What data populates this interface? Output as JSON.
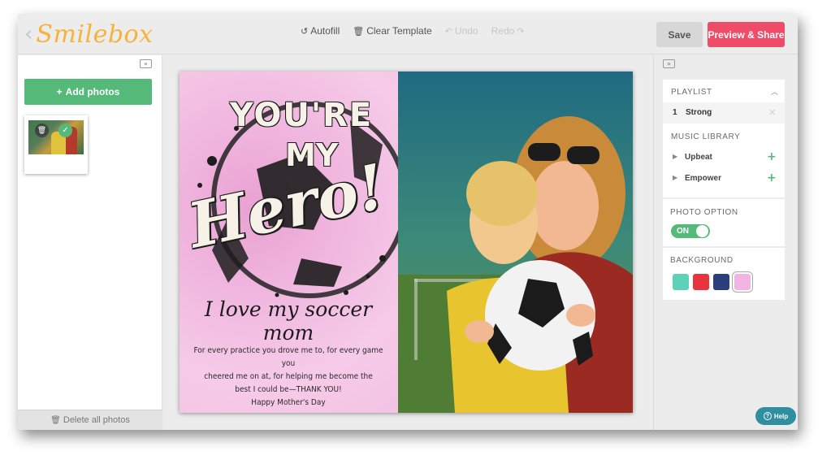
{
  "app": {
    "logo": "Smilebox"
  },
  "toolbar": {
    "autofill": "Autofill",
    "clear_template": "Clear Template",
    "undo": "Undo",
    "redo": "Redo",
    "save": "Save",
    "preview_share": "Preview & Share"
  },
  "left_panel": {
    "add_photos": "Add photos",
    "delete_all": "Delete all photos"
  },
  "card": {
    "headline_1": "YOU'RE",
    "headline_2": "MY",
    "headline_3": "Hero!",
    "subtitle": "I love my soccer mom",
    "body_lines": [
      "For every practice you drove me to, for every game you",
      "cheered me on at, for helping me become the",
      "best I could be—THANK YOU!",
      "Happy Mother's Day"
    ]
  },
  "right_panel": {
    "playlist_title": "PLAYLIST",
    "playlist": [
      {
        "num": "1",
        "name": "Strong"
      }
    ],
    "music_library_title": "MUSIC LIBRARY",
    "music_library": [
      {
        "name": "Upbeat"
      },
      {
        "name": "Empower"
      }
    ],
    "photo_option_title": "PHOTO OPTION",
    "photo_option_value": "ON",
    "background_title": "BACKGROUND",
    "background_swatches": [
      "#5fd1b9",
      "#e8343f",
      "#2a3f7c",
      "#f2b4e2"
    ],
    "selected_background": "#f2b4e2"
  },
  "help": {
    "label": "Help"
  }
}
